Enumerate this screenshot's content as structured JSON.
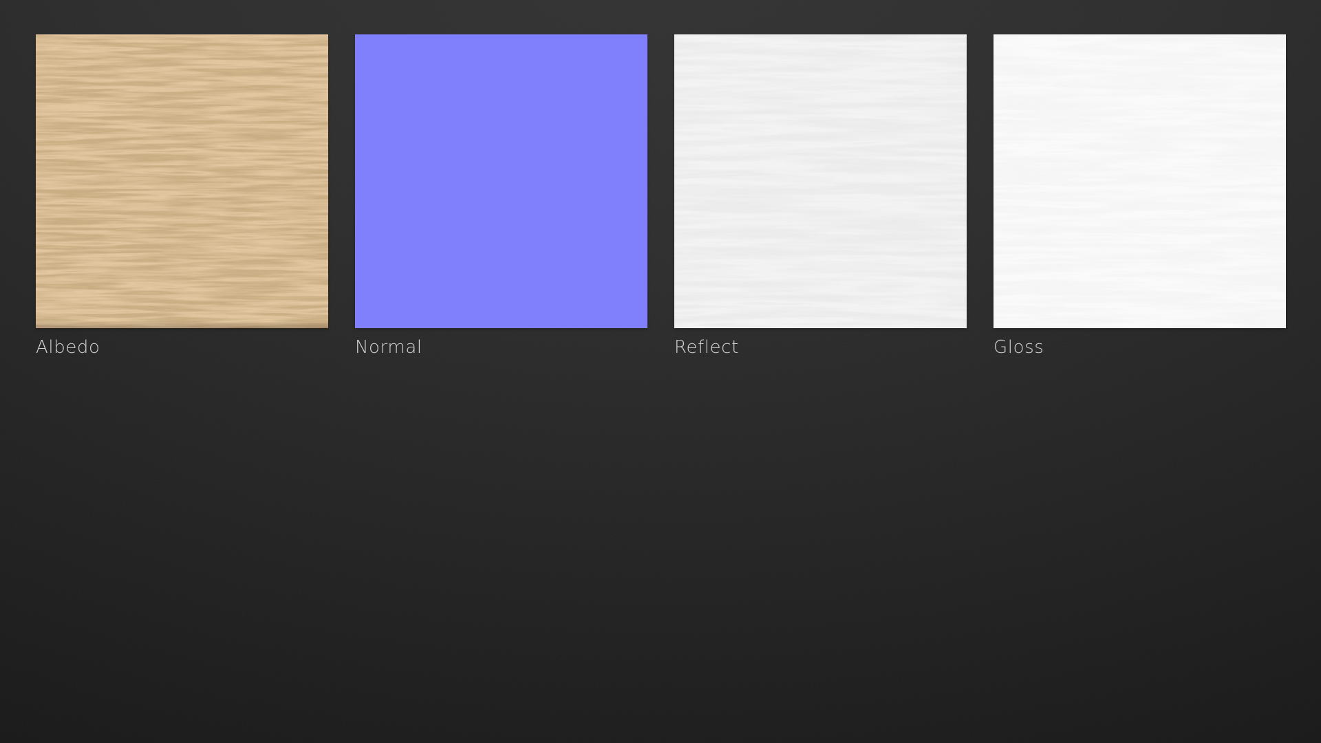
{
  "page": {
    "background_top_color": "#303030",
    "background_bottom_color": "#1b1b1b",
    "label_text_color": "#d3d3d3"
  },
  "textures": [
    {
      "label": "Albedo",
      "base_color": "#a87c4a",
      "appearance": "wood-grain-brown"
    },
    {
      "label": "Normal",
      "base_color": "#8080fc",
      "appearance": "flat-normal-map-purple"
    },
    {
      "label": "Reflect",
      "base_color": "#d8d8d8",
      "appearance": "brushed-light-gray"
    },
    {
      "label": "Gloss",
      "base_color": "#ededed",
      "appearance": "brushed-near-white"
    }
  ]
}
